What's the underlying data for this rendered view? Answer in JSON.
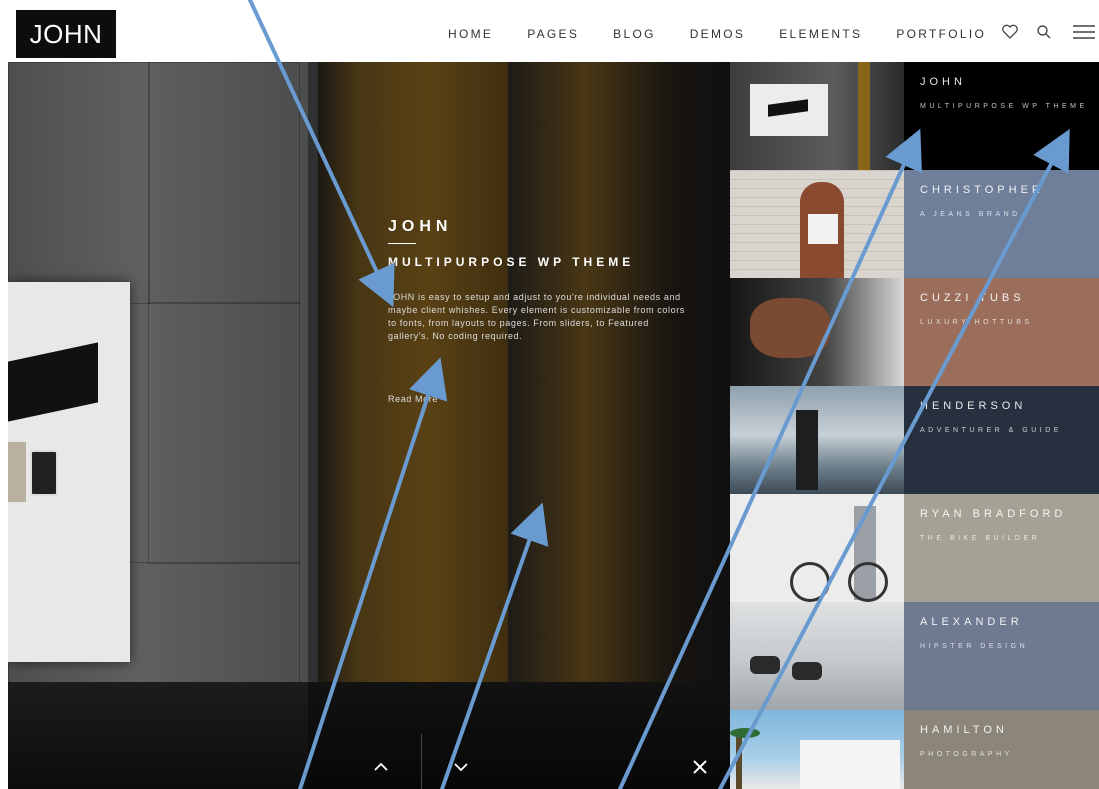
{
  "header": {
    "logo": "JOHN",
    "nav": [
      "HOME",
      "PAGES",
      "BLOG",
      "DEMOS",
      "ELEMENTS",
      "PORTFOLIO"
    ],
    "icons": [
      "heart-icon",
      "search-icon",
      "menu-icon"
    ]
  },
  "hero": {
    "title": "JOHN",
    "subtitle": "MULTIPURPOSE WP THEME",
    "description": "JOHN is easy to setup and adjust to you're individual needs and maybe client whishes. Every element is customizable from colors to fonts, from layouts to pages. From sliders, to Featured gallery's. No coding required.",
    "read_more": "Read More",
    "controls": [
      "chevron-up-icon",
      "chevron-down-icon",
      "close-icon"
    ]
  },
  "portfolio": [
    {
      "name": "JOHN",
      "subtitle": "MULTIPURPOSE WP THEME",
      "color": "#000000"
    },
    {
      "name": "CHRISTOPHER",
      "subtitle": "A JEANS BRAND",
      "color": "#6f7f99"
    },
    {
      "name": "CUZZI TUBS",
      "subtitle": "LUXURY HOTTUBS",
      "color": "#9a6e5b"
    },
    {
      "name": "HENDERSON",
      "subtitle": "ADVENTURER & GUIDE",
      "color": "#26303f"
    },
    {
      "name": "RYAN BRADFORD",
      "subtitle": "THE BIKE BUILDER",
      "color": "#a5a295"
    },
    {
      "name": "ALEXANDER",
      "subtitle": "HIPSTER DESIGN",
      "color": "#6f7a90"
    },
    {
      "name": "HAMILTON",
      "subtitle": "PHOTOGRAPHY",
      "color": "#8c8579"
    }
  ],
  "colors": {
    "arrow": "#6a9bd0",
    "header_bg": "#ffffff",
    "logo_bg": "#0d0d0d"
  }
}
